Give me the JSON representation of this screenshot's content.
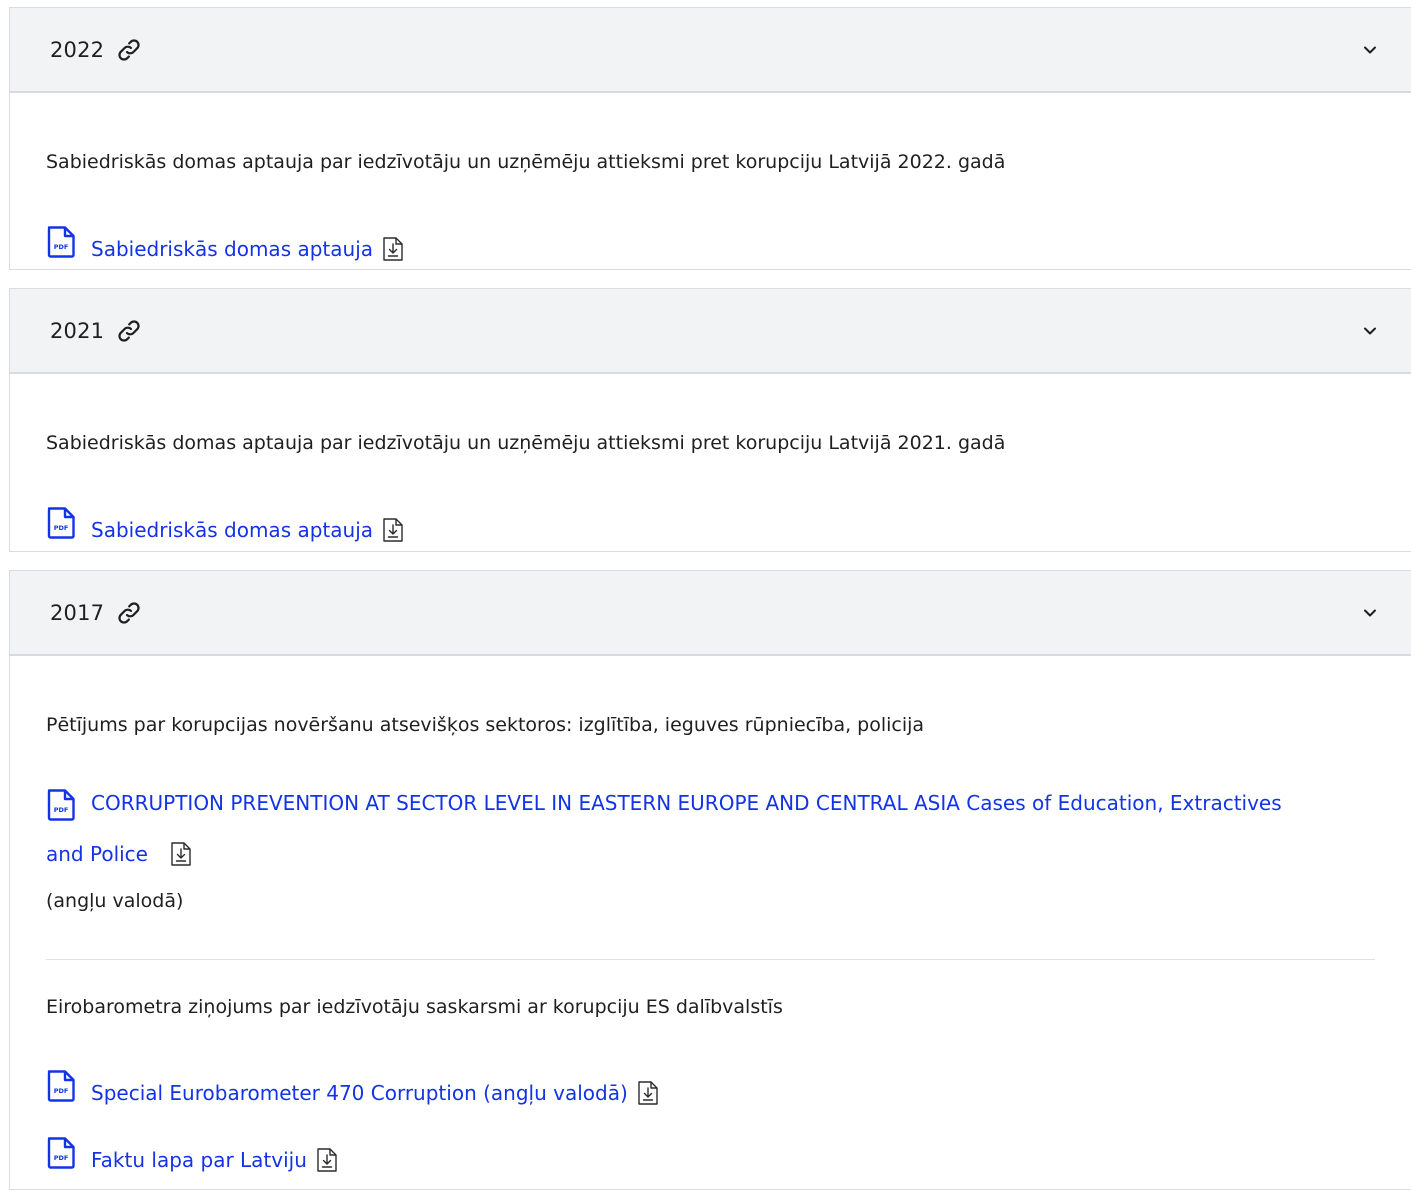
{
  "sections": [
    {
      "year": "2022",
      "description": "Sabiedriskās domas aptauja par iedzīvotāju un uzņēmēju attieksmi pret korupciju Latvijā 2022. gadā",
      "files": [
        {
          "label": "Sabiedriskās domas aptauja",
          "icon": "pdf-icon"
        }
      ]
    },
    {
      "year": "2021",
      "description": "Sabiedriskās domas aptauja par iedzīvotāju un uzņēmēju attieksmi pret korupciju Latvijā 2021. gadā",
      "files": [
        {
          "label": "Sabiedriskās domas aptauja",
          "icon": "pdf-icon"
        }
      ]
    },
    {
      "year": "2017",
      "description": "Pētījums par korupcijas novēršanu atsevišķos sektoros: izglītība, ieguves rūpniecība, policija",
      "files": [
        {
          "label_line1": "CORRUPTION PREVENTION AT SECTOR LEVEL IN EASTERN EUROPE AND CENTRAL ASIA Cases of Education, Extractives",
          "label_line2": "and Police",
          "icon": "pdf-icon"
        }
      ],
      "note": "(angļu valodā)",
      "description2": "Eirobarometra ziņojums par iedzīvotāju saskarsmi ar korupciju ES dalībvalstīs",
      "files2": [
        {
          "label": "Special Eurobarometer 470 Corruption (angļu valodā)",
          "icon": "pdf-icon"
        },
        {
          "label": "Faktu lapa par Latviju",
          "icon": "pdf-icon"
        }
      ]
    }
  ],
  "colors": {
    "link": "#1433e6",
    "header_bg": "#f2f3f5",
    "text": "#1f1f1f"
  }
}
